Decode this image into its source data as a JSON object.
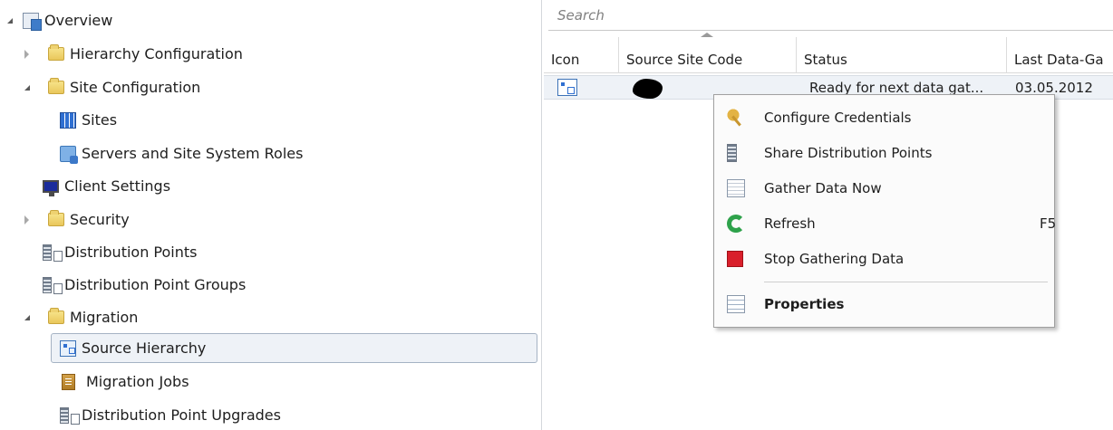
{
  "nav": {
    "items": [
      {
        "label": "Overview",
        "icon": "overview-icon",
        "expander": "expanded"
      },
      {
        "label": "Hierarchy Configuration",
        "icon": "folder-icon",
        "expander": "collapsed"
      },
      {
        "label": "Site Configuration",
        "icon": "folder-icon",
        "expander": "expanded"
      },
      {
        "label": "Sites",
        "icon": "sites-icon",
        "expander": "none"
      },
      {
        "label": "Servers and Site System Roles",
        "icon": "servers-icon",
        "expander": "none"
      },
      {
        "label": "Client Settings",
        "icon": "client-settings-icon",
        "expander": "none"
      },
      {
        "label": "Security",
        "icon": "folder-icon",
        "expander": "collapsed"
      },
      {
        "label": "Distribution Points",
        "icon": "distribution-points-icon",
        "expander": "none"
      },
      {
        "label": "Distribution Point Groups",
        "icon": "distribution-point-groups-icon",
        "expander": "none"
      },
      {
        "label": "Migration",
        "icon": "folder-icon",
        "expander": "expanded"
      },
      {
        "label": "Source Hierarchy",
        "icon": "source-hierarchy-icon",
        "expander": "none",
        "selected": true
      },
      {
        "label": "Migration Jobs",
        "icon": "migration-jobs-icon",
        "expander": "none"
      },
      {
        "label": "Distribution Point Upgrades",
        "icon": "distribution-point-upgrades-icon",
        "expander": "none"
      }
    ]
  },
  "search": {
    "placeholder": "Search",
    "value": ""
  },
  "grid": {
    "columns": [
      "Icon",
      "Source Site Code",
      "Status",
      "Last Data-Ga"
    ],
    "sorted_column": "Source Site Code",
    "rows": [
      {
        "icon": "source-hierarchy-icon",
        "source_site_code": "",
        "status": "Ready for next data gat...",
        "last_data_gathering": "03.05.2012"
      }
    ]
  },
  "context_menu": {
    "items": [
      {
        "label": "Configure Credentials",
        "icon": "key-icon",
        "shortcut": ""
      },
      {
        "label": "Share Distribution Points",
        "icon": "share-distribution-points-icon",
        "shortcut": ""
      },
      {
        "label": "Gather Data Now",
        "icon": "gather-data-icon",
        "shortcut": ""
      },
      {
        "label": "Refresh",
        "icon": "refresh-icon",
        "shortcut": "F5"
      },
      {
        "label": "Stop Gathering Data",
        "icon": "stop-icon",
        "shortcut": ""
      },
      {
        "label": "Properties",
        "icon": "properties-icon",
        "shortcut": "",
        "bold": true
      }
    ]
  },
  "colors": {
    "selection_background": "#eef2f7",
    "selection_border": "#a5b3c4",
    "folder": "#e9c75b",
    "stop": "#d91f2b",
    "refresh": "#2ea24b"
  }
}
